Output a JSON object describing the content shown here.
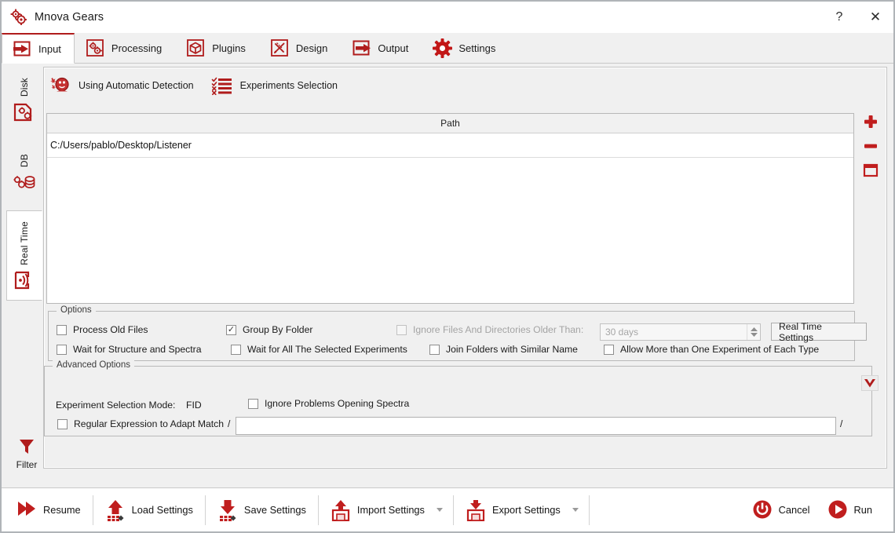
{
  "window": {
    "title": "Mnova Gears",
    "title_icon": "gears-icon",
    "help_label": "?",
    "close_label": "✕"
  },
  "tabs": [
    {
      "label": "Input",
      "icon": "arrow-into-box-icon",
      "active": true
    },
    {
      "label": "Processing",
      "icon": "gears-icon",
      "active": false
    },
    {
      "label": "Plugins",
      "icon": "box-package-icon",
      "active": false
    },
    {
      "label": "Design",
      "icon": "pencil-ruler-icon",
      "active": false
    },
    {
      "label": "Output",
      "icon": "arrow-out-box-icon",
      "active": false
    },
    {
      "label": "Settings",
      "icon": "gear-icon",
      "active": false
    }
  ],
  "side_tabs": [
    {
      "label": "Disk",
      "icon": "disk-gears-icon",
      "active": false
    },
    {
      "label": "DB",
      "icon": "database-gears-icon",
      "active": false
    },
    {
      "label": "Real Time",
      "icon": "signal-waves-icon",
      "active": true
    }
  ],
  "filter": {
    "label": "Filter",
    "icon": "funnel-icon"
  },
  "mode_bar": [
    {
      "label": "Using Automatic Detection",
      "icon": "auto-detection-icon"
    },
    {
      "label": "Experiments Selection",
      "icon": "checklist-icon"
    }
  ],
  "path_table": {
    "columns": [
      "Path"
    ],
    "rows": [
      "C:/Users/pablo/Desktop/Listener"
    ]
  },
  "side_buttons": [
    {
      "name": "add-path-button",
      "icon": "plus-icon"
    },
    {
      "name": "remove-path-button",
      "icon": "minus-icon"
    },
    {
      "name": "clear-paths-button",
      "icon": "window-icon"
    }
  ],
  "options": {
    "title": "Options",
    "checkboxes": [
      {
        "label": "Process Old Files",
        "checked": false,
        "disabled": false
      },
      {
        "label": "Group By Folder",
        "checked": true,
        "disabled": false
      },
      {
        "label": "Ignore Files And Directories Older Than:",
        "checked": false,
        "disabled": true
      },
      {
        "label": "Wait for Structure and Spectra",
        "checked": false,
        "disabled": false
      },
      {
        "label": "Wait for All The Selected Experiments",
        "checked": false,
        "disabled": false
      },
      {
        "label": "Join Folders with Similar Name",
        "checked": false,
        "disabled": false
      },
      {
        "label": "Allow More than One Experiment of Each Type",
        "checked": false,
        "disabled": false
      }
    ],
    "age_spinner": {
      "value": "30 days",
      "disabled": true
    },
    "real_time_settings_button": "Real Time Settings"
  },
  "advanced_options": {
    "title": "Advanced Options",
    "collapse_icon": "chevron-down-icon",
    "experiment_selection_mode_label": "Experiment Selection Mode:",
    "experiment_selection_mode_value": "FID",
    "ignore_problems": {
      "label": "Ignore Problems Opening Spectra",
      "checked": false
    },
    "regex": {
      "label": "Regular Expression to Adapt Match",
      "checked": false,
      "prefix": "/",
      "suffix": "/",
      "value": "",
      "placeholder": ""
    }
  },
  "bottom_bar": {
    "buttons": [
      {
        "label": "Resume",
        "icon": "double-play-icon",
        "caret": false
      },
      {
        "label": "Load Settings",
        "icon": "upload-arrow-icon",
        "caret": false
      },
      {
        "label": "Save Settings",
        "icon": "download-arrow-icon",
        "caret": false
      },
      {
        "label": "Import Settings",
        "icon": "import-disk-icon",
        "caret": true
      },
      {
        "label": "Export Settings",
        "icon": "export-disk-icon",
        "caret": true
      }
    ],
    "cancel": {
      "label": "Cancel",
      "icon": "power-icon"
    },
    "run": {
      "label": "Run",
      "icon": "play-circle-icon"
    }
  },
  "colors": {
    "accent_red": "#b01c1c",
    "bright_red": "#d21616",
    "panel_bg": "#f0f0f0",
    "white": "#ffffff",
    "border": "#c4c4c4",
    "disabled_text": "#a4a4a4"
  }
}
